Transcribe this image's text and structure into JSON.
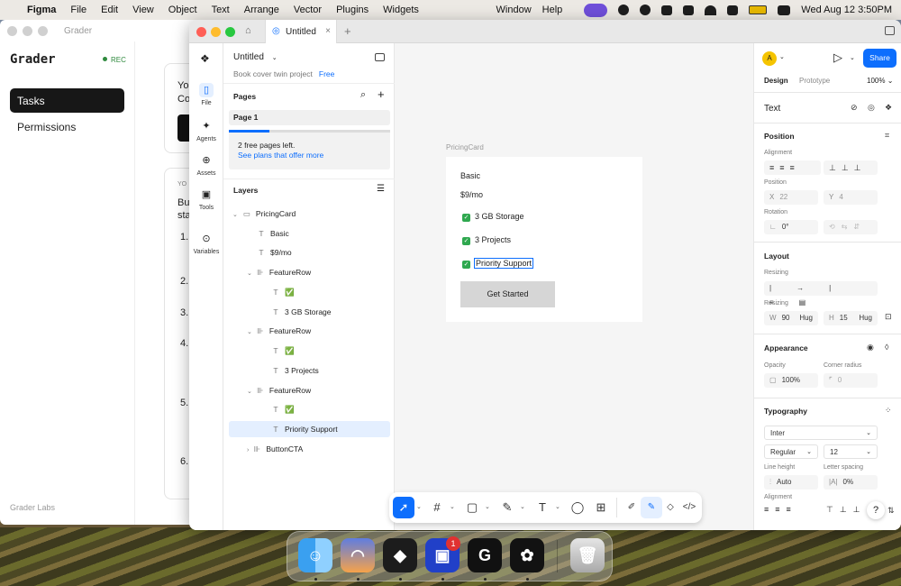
{
  "menubar": {
    "app": "Figma",
    "items": [
      "File",
      "Edit",
      "View",
      "Object",
      "Text",
      "Arrange",
      "Vector",
      "Plugins",
      "Widgets"
    ],
    "right_items": [
      "Window",
      "Help"
    ],
    "datetime": "Wed Aug 12  3:50PM"
  },
  "grader": {
    "title": "Grader",
    "brand": "Grader",
    "rec": "REC",
    "nav": [
      "Tasks",
      "Permissions"
    ],
    "footer": "Grader Labs",
    "peek": {
      "card1_a": "Yo",
      "card1_b": "Co",
      "card2_label": "YO",
      "card2_a": "Bu",
      "card2_b": "sta",
      "steps": [
        "1.",
        "2.",
        "3.",
        "4.",
        "5.",
        "6."
      ]
    }
  },
  "figma": {
    "tab_title": "Untitled",
    "file_name": "Untitled",
    "project": "Book cover twin project",
    "plan": "Free",
    "rail": [
      {
        "label": "File",
        "icon": "file-icon"
      },
      {
        "label": "Agents",
        "icon": "agents-icon"
      },
      {
        "label": "Assets",
        "icon": "assets-icon"
      },
      {
        "label": "Tools",
        "icon": "tools-icon"
      },
      {
        "label": "Variables",
        "icon": "variables-icon"
      }
    ],
    "pages_title": "Pages",
    "page": "Page 1",
    "page_progress": 0.25,
    "free_pages": "2 free pages left.",
    "see_plans": "See plans that offer more",
    "layers_title": "Layers",
    "layers": [
      {
        "label": "PricingCard",
        "glyph": "▭",
        "caret": "⌄"
      },
      {
        "label": "Basic",
        "glyph": "T"
      },
      {
        "label": "$9/mo",
        "glyph": "T"
      },
      {
        "label": "FeatureRow",
        "glyph": "⊪",
        "caret": "⌄"
      },
      {
        "label": "✅",
        "glyph": "T"
      },
      {
        "label": "3 GB Storage",
        "glyph": "T"
      },
      {
        "label": "FeatureRow",
        "glyph": "⊪",
        "caret": "⌄"
      },
      {
        "label": "✅",
        "glyph": "T"
      },
      {
        "label": "3 Projects",
        "glyph": "T"
      },
      {
        "label": "FeatureRow",
        "glyph": "⊪",
        "caret": "⌄"
      },
      {
        "label": "✅",
        "glyph": "T"
      },
      {
        "label": "Priority Support",
        "glyph": "T"
      },
      {
        "label": "ButtonCTA",
        "glyph": "⊪",
        "caret": "›"
      }
    ],
    "canvas": {
      "frame_label": "PricingCard",
      "plan_name": "Basic",
      "price": "$9/mo",
      "features": [
        "3 GB Storage",
        "3 Projects",
        "Priority Support"
      ],
      "cta": "Get Started"
    },
    "right": {
      "avatar": "A",
      "share": "Share",
      "tab_design": "Design",
      "tab_prototype": "Prototype",
      "zoom": "100%",
      "section_text": "Text",
      "position_title": "Position",
      "alignment_label": "Alignment",
      "position_label": "Position",
      "x_label": "X",
      "x_value": "22",
      "y_label": "Y",
      "y_value": "4",
      "rotation_label": "Rotation",
      "rotation_value": "0°",
      "layout_title": "Layout",
      "resizing_label": "Resizing",
      "resizing_label2": "Resizing",
      "w_label": "W",
      "w_value": "90",
      "w_mode": "Hug",
      "h_label": "H",
      "h_value": "15",
      "h_mode": "Hug",
      "appearance_title": "Appearance",
      "opacity_label": "Opacity",
      "opacity_value": "100%",
      "corner_label": "Corner radius",
      "corner_value": "0",
      "typography_title": "Typography",
      "font": "Inter",
      "weight": "Regular",
      "size": "12",
      "line_height_label": "Line height",
      "line_height_value": "Auto",
      "letter_spacing_label": "Letter spacing",
      "letter_spacing_value": "0%",
      "alignment_label2": "Alignment",
      "help": "?"
    }
  },
  "dock": {
    "apps": [
      "Finder",
      "Arc",
      "Linear",
      "Notchmeister",
      "Grader",
      "Figma",
      "Trash"
    ],
    "badge": "1"
  }
}
